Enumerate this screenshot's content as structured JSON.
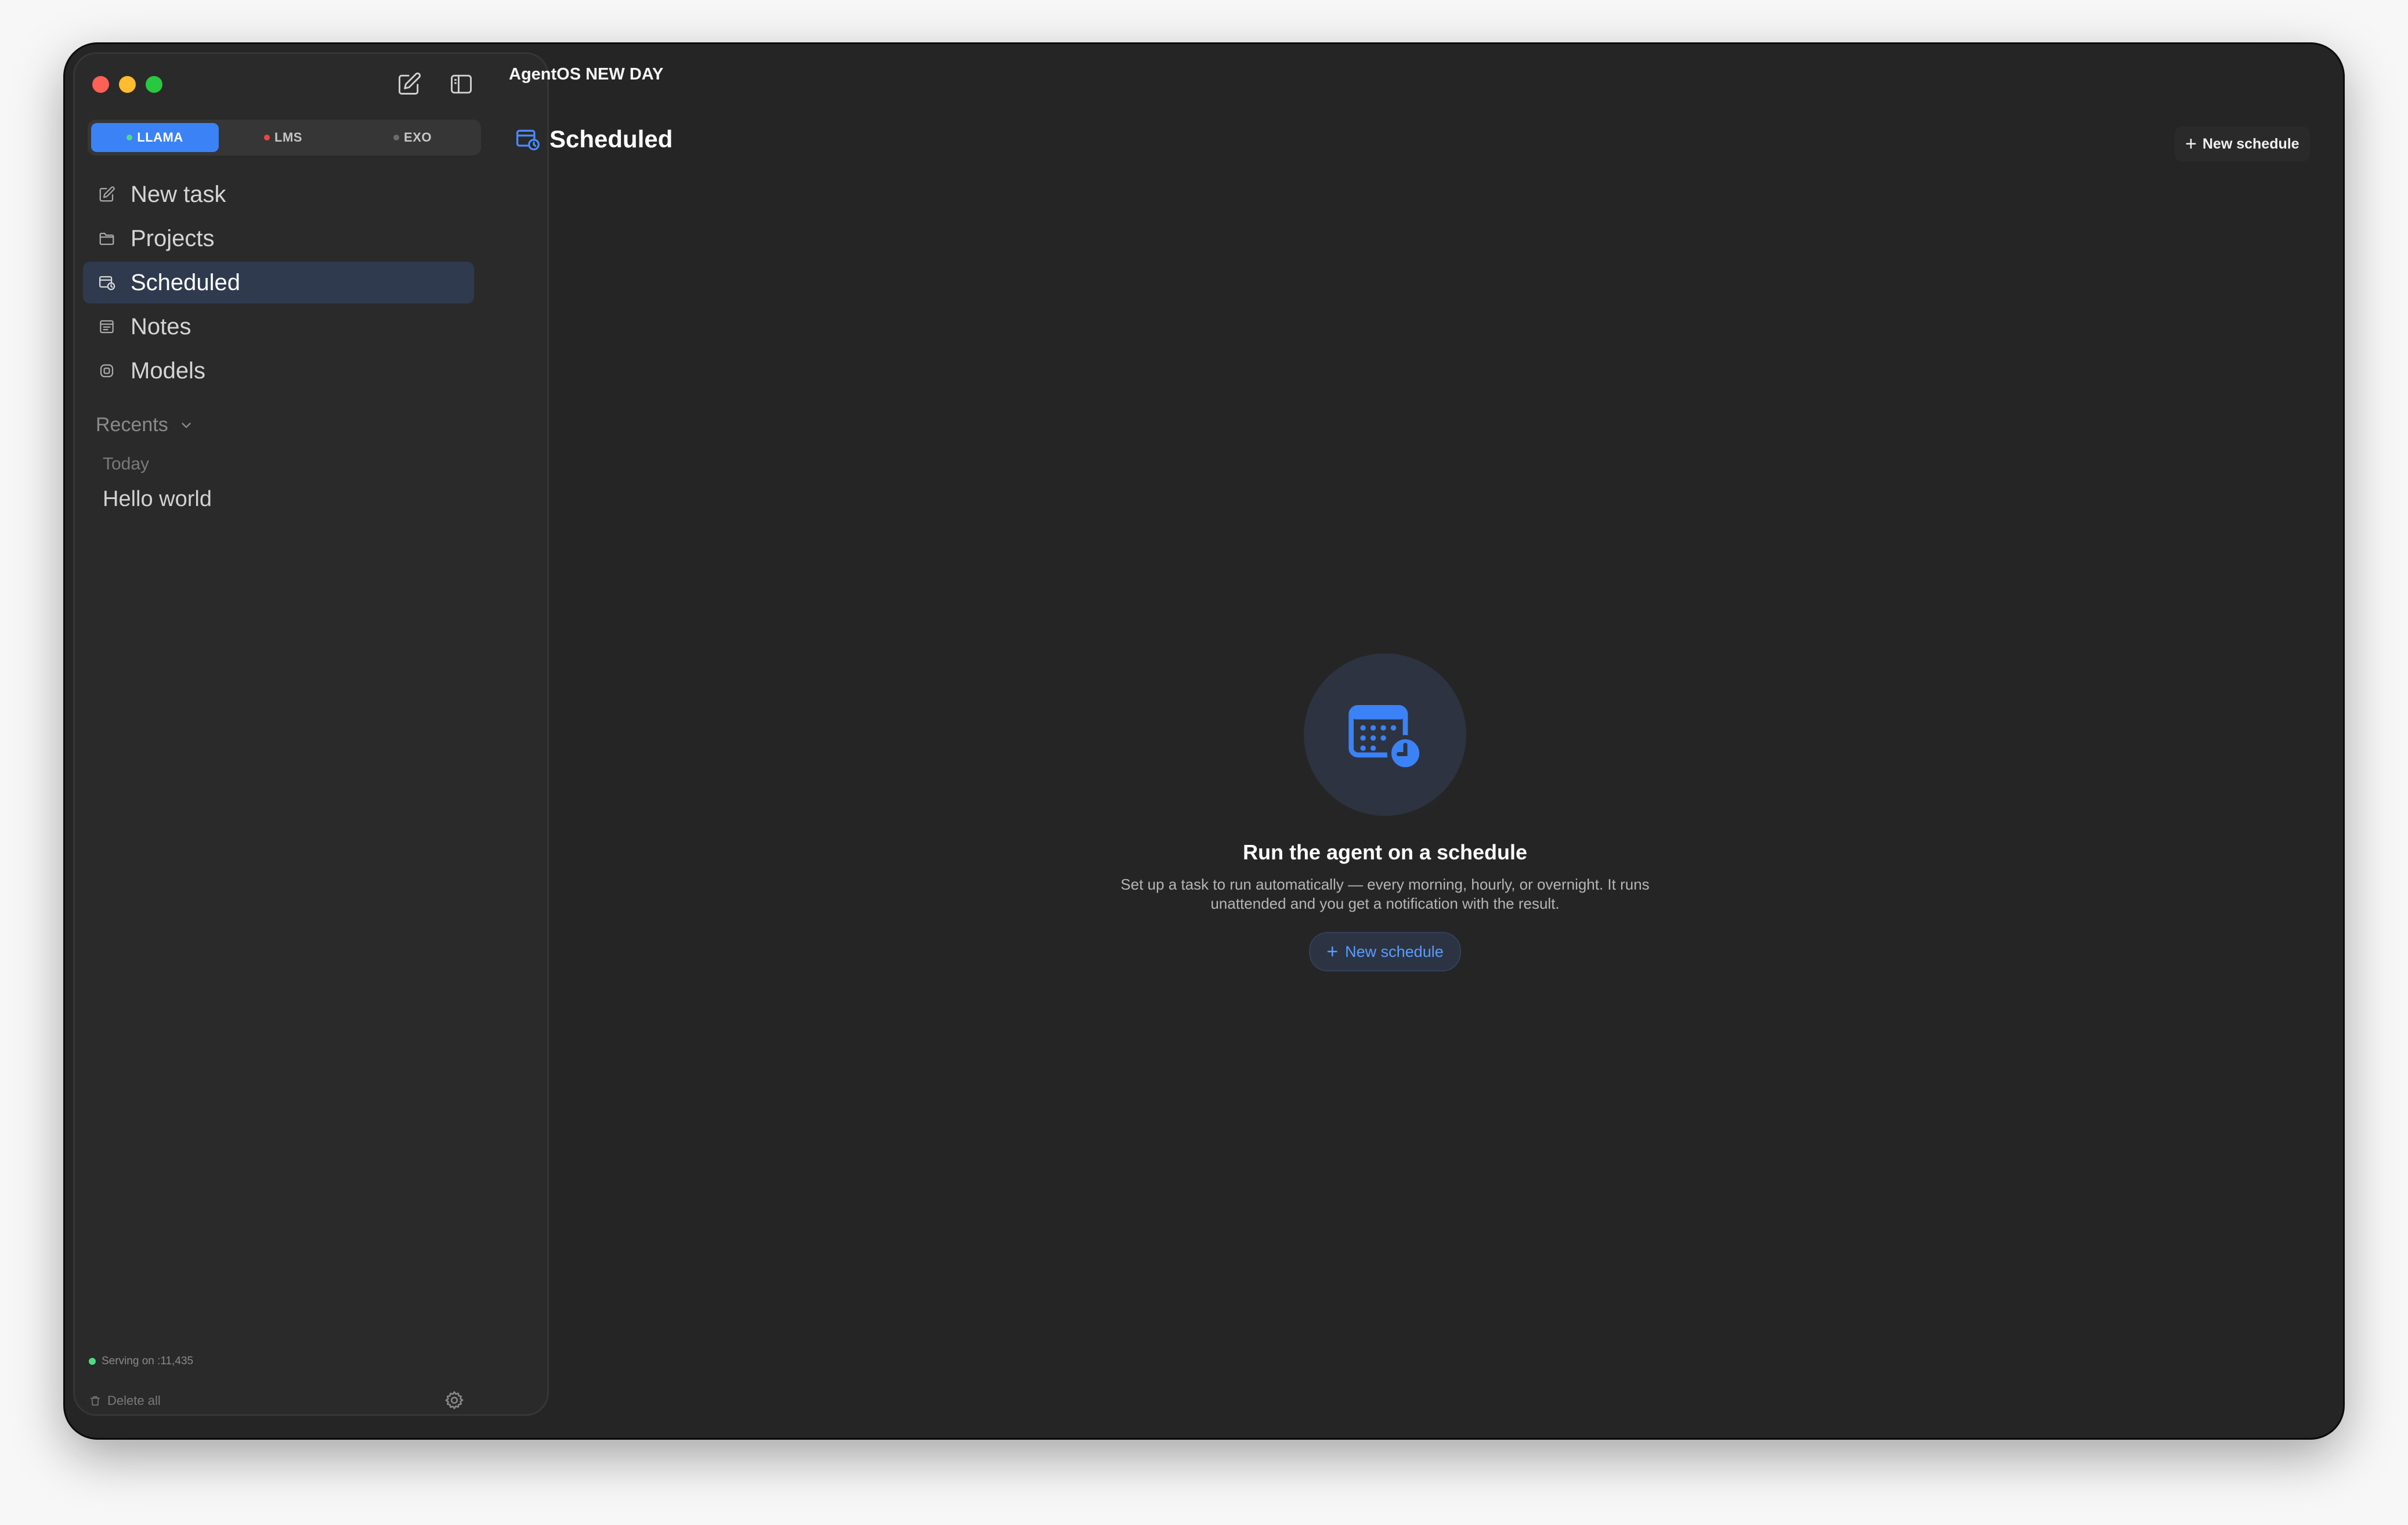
{
  "app": {
    "title": "AgentOS NEW DAY"
  },
  "backends": [
    {
      "label": "LLAMA",
      "status_color": "#4ade80",
      "selected": true
    },
    {
      "label": "LMS",
      "status_color": "#ef4444",
      "selected": false
    },
    {
      "label": "EXO",
      "status_color": "#6b6b6b",
      "selected": false
    }
  ],
  "nav": [
    {
      "label": "New task",
      "icon": "compose-icon"
    },
    {
      "label": "Projects",
      "icon": "folder-icon"
    },
    {
      "label": "Scheduled",
      "icon": "calendar-clock-icon",
      "active": true
    },
    {
      "label": "Notes",
      "icon": "notes-icon"
    },
    {
      "label": "Models",
      "icon": "cube-icon"
    }
  ],
  "recents": {
    "heading": "Recents",
    "group": "Today",
    "items": [
      "Hello world"
    ]
  },
  "footer": {
    "serving": "Serving on :11,435",
    "serving_color": "#4ade80",
    "delete_all": "Delete all"
  },
  "page": {
    "title": "Scheduled",
    "new_schedule": "New schedule"
  },
  "empty_state": {
    "title": "Run the agent on a schedule",
    "description": "Set up a task to run automatically — every morning, hourly, or overnight. It runs unattended and you get a notification with the result.",
    "button": "New schedule"
  },
  "colors": {
    "accent": "#3b82f6",
    "background": "#252525",
    "sidebar": "#2a2a2a"
  }
}
